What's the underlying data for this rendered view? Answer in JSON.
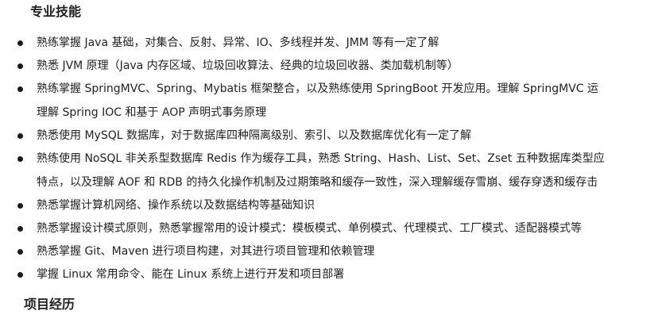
{
  "section_skills_title": "专业技能",
  "section_projects_title": "项目经历",
  "skills": [
    {
      "lines": [
        "熟练掌握 Java 基础，对集合、反射、异常、IO、多线程并发、JMM 等有一定了解"
      ]
    },
    {
      "lines": [
        "熟悉 JVM 原理（Java 内存区域、垃圾回收算法、经典的垃圾回收器、类加载机制等）"
      ]
    },
    {
      "lines": [
        "熟练掌握 SpringMVC、Spring、Mybatis 框架整合，以及熟练使用 SpringBoot 开发应用。理解 SpringMVC 运",
        "理解 Spring IOC 和基于 AOP 声明式事务原理"
      ]
    },
    {
      "lines": [
        "熟悉使用 MySQL 数据库，对于数据库四种隔离级别、索引、以及数据库优化有一定了解"
      ]
    },
    {
      "lines": [
        "熟练使用 NoSQL 非关系型数据库 Redis 作为缓存工具，熟悉 String、Hash、List、Set、Zset 五种数据库类型应",
        "特点，以及理解 AOF 和 RDB 的持久化操作机制及过期策略和缓存一致性，深入理解缓存雪崩、缓存穿透和缓存击"
      ]
    },
    {
      "lines": [
        "熟悉掌握计算机网络、操作系统以及数据结构等基础知识"
      ]
    },
    {
      "lines": [
        "熟悉掌握设计模式原则，熟悉掌握常用的设计模式：模板模式、单例模式、代理模式、工厂模式、适配器模式等"
      ]
    },
    {
      "lines": [
        "熟悉掌握 Git、Maven 进行项目构建，对其进行项目管理和依赖管理"
      ]
    },
    {
      "lines": [
        "掌握 Linux 常用命令、能在 Linux 系统上进行开发和项目部署"
      ]
    }
  ]
}
